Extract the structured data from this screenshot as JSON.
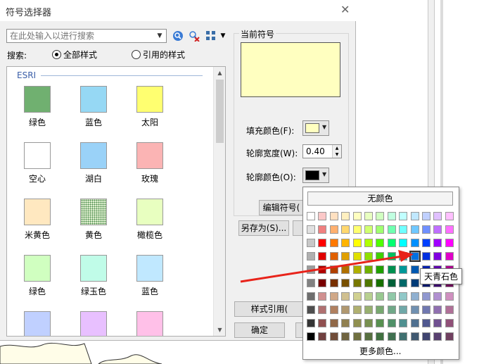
{
  "dialog": {
    "title": "符号选择器",
    "search": {
      "placeholder": "在此处输入以进行搜索"
    },
    "search_by_label": "搜索:",
    "radio_all": "全部样式",
    "radio_referenced": "引用的样式",
    "group_name": "ESRI",
    "symbols": [
      {
        "label": "绿色",
        "color": "#70b070"
      },
      {
        "label": "蓝色",
        "color": "#96d8f4"
      },
      {
        "label": "太阳",
        "color": "#ffff70"
      },
      {
        "label": "空心",
        "color": "#ffffff"
      },
      {
        "label": "湖白",
        "color": "#9ad2f8"
      },
      {
        "label": "玫瑰",
        "color": "#fbb4b4"
      },
      {
        "label": "米黄色",
        "color": "#ffe8c0"
      },
      {
        "label": "黄色",
        "color": "#d8f0c0"
      },
      {
        "label": "橄榄色",
        "color": "#e8ffc0"
      },
      {
        "label": "绿色",
        "color": "#d0ffc0"
      },
      {
        "label": "绿玉色",
        "color": "#c0fce8"
      },
      {
        "label": "蓝色",
        "color": "#c0e8ff"
      },
      {
        "label": "",
        "color": "#c0d0ff"
      },
      {
        "label": "",
        "color": "#e8c0ff"
      },
      {
        "label": "",
        "color": "#ffc0e8"
      }
    ],
    "current_symbol_label": "当前符号",
    "preview_color": "#ffffc0",
    "fill_color_label": "填充颜色(F):",
    "fill_color": "#ffffc0",
    "outline_width_label": "轮廓宽度(W):",
    "outline_width": "0.40",
    "outline_color_label": "轮廓颜色(O):",
    "outline_color": "#000000",
    "edit_symbol_button": "编辑符号(",
    "save_as_button": "另存为(S)...",
    "style_ref_button": "样式引用(",
    "ok_button": "确定"
  },
  "color_popup": {
    "no_color_label": "无颜色",
    "more_colors_label": "更多颜色...",
    "tooltip": "天青石色",
    "rows": [
      [
        "#ffffff",
        "#fbc8c8",
        "#ffe0c0",
        "#fff0c0",
        "#ffffc0",
        "#e8ffc0",
        "#d0ffc0",
        "#c0ffe0",
        "#c0ffff",
        "#c0e8ff",
        "#c0d0ff",
        "#e0c0ff",
        "#ffc0ff"
      ],
      [
        "#e1e1e1",
        "#f08080",
        "#ffb070",
        "#ffd870",
        "#ffff70",
        "#d0ff70",
        "#a0ff70",
        "#70ffb0",
        "#70ffff",
        "#70c8ff",
        "#7090ff",
        "#c070ff",
        "#ff70ff"
      ],
      [
        "#c8c8c8",
        "#ff0000",
        "#ff7800",
        "#ffb400",
        "#ffff00",
        "#b0ff00",
        "#50ff00",
        "#00ff70",
        "#00ffff",
        "#0090ff",
        "#0040ff",
        "#a000ff",
        "#ff00ff"
      ],
      [
        "#b0b0b0",
        "#e00000",
        "#e06000",
        "#e0a000",
        "#e0e000",
        "#90e000",
        "#40d000",
        "#00c060",
        "#00c8c8",
        "#0070e0",
        "#0030e0",
        "#8000e0",
        "#e000c8"
      ],
      [
        "#9c9c9c",
        "#b00000",
        "#b04000",
        "#b07000",
        "#b0b000",
        "#70b000",
        "#20a000",
        "#009050",
        "#009898",
        "#0058b0",
        "#0020b0",
        "#6000b0",
        "#b00090"
      ],
      [
        "#828282",
        "#780000",
        "#783000",
        "#785000",
        "#787800",
        "#507800",
        "#187000",
        "#006038",
        "#006868",
        "#003c78",
        "#001878",
        "#400078",
        "#780060"
      ],
      [
        "#6e6e6e",
        "#d09090",
        "#d0a888",
        "#d0c090",
        "#d0d090",
        "#b8d090",
        "#98c890",
        "#90c8a8",
        "#90c8c8",
        "#90b0d0",
        "#9098d0",
        "#b090d0",
        "#d090c0"
      ],
      [
        "#4e4e4e",
        "#b07070",
        "#b08060",
        "#b09870",
        "#b0b070",
        "#98b070",
        "#78a870",
        "#70a888",
        "#70a8a8",
        "#7090b0",
        "#7078b0",
        "#9070b0",
        "#b07098"
      ],
      [
        "#343434",
        "#905050",
        "#906848",
        "#908050",
        "#909050",
        "#789050",
        "#589050",
        "#509068",
        "#509090",
        "#507090",
        "#505890",
        "#705090",
        "#905078"
      ],
      [
        "#000000",
        "#704040",
        "#704c38",
        "#706440",
        "#707040",
        "#587040",
        "#407040",
        "#407050",
        "#407070",
        "#405870",
        "#404470",
        "#584070",
        "#704060"
      ]
    ]
  }
}
